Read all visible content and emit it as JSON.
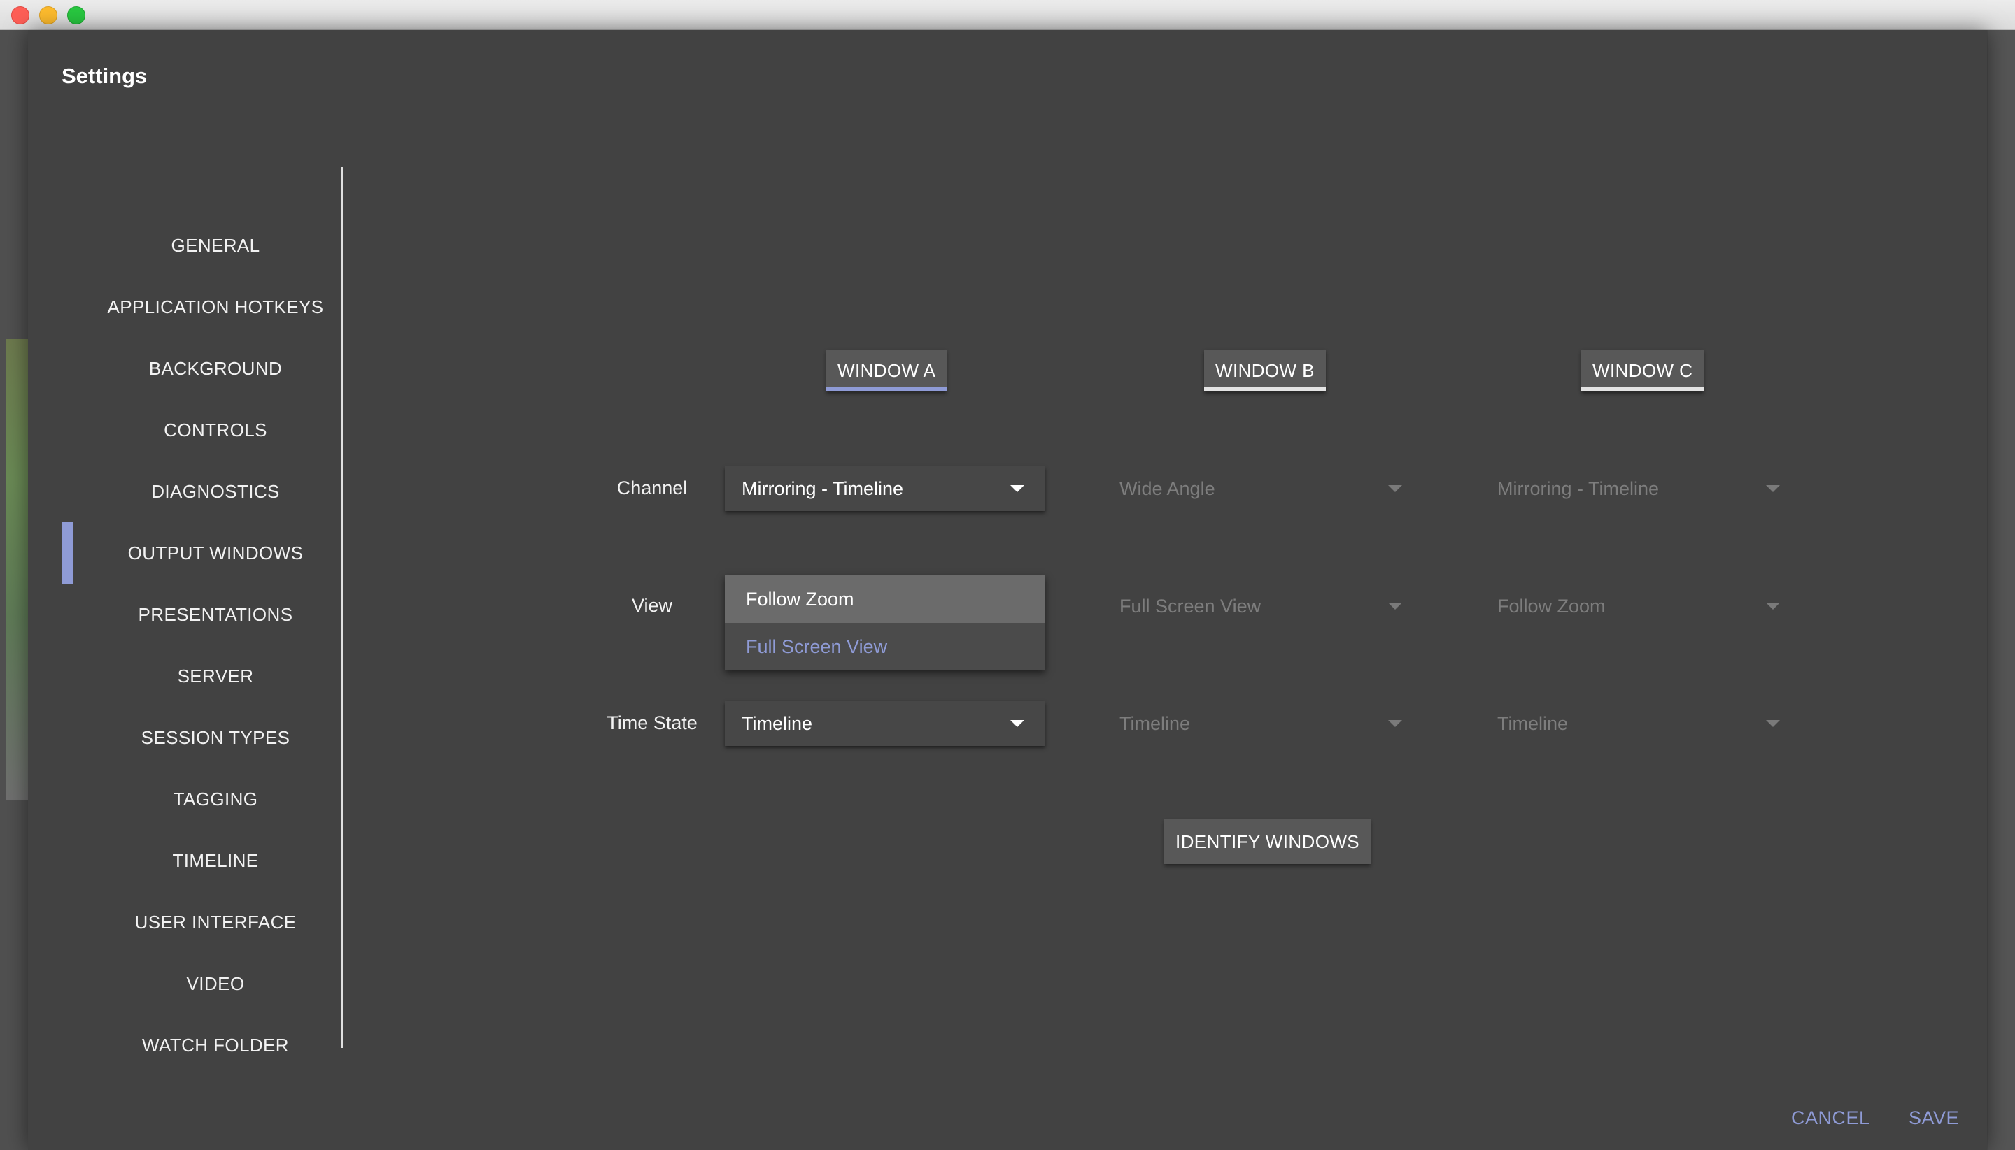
{
  "dialog": {
    "title": "Settings"
  },
  "nav": {
    "items": [
      {
        "label": "GENERAL"
      },
      {
        "label": "APPLICATION HOTKEYS"
      },
      {
        "label": "BACKGROUND"
      },
      {
        "label": "CONTROLS"
      },
      {
        "label": "DIAGNOSTICS"
      },
      {
        "label": "OUTPUT WINDOWS",
        "active": true
      },
      {
        "label": "PRESENTATIONS"
      },
      {
        "label": "SERVER"
      },
      {
        "label": "SESSION TYPES"
      },
      {
        "label": "TAGGING"
      },
      {
        "label": "TIMELINE"
      },
      {
        "label": "USER INTERFACE"
      },
      {
        "label": "VIDEO"
      },
      {
        "label": "WATCH FOLDER"
      }
    ]
  },
  "windows": [
    {
      "label": "WINDOW A",
      "active": true
    },
    {
      "label": "WINDOW B",
      "active": false
    },
    {
      "label": "WINDOW C",
      "active": false
    }
  ],
  "rows": {
    "channel": {
      "label": "Channel",
      "values": [
        "Mirroring - Timeline",
        "Wide Angle",
        "Mirroring - Timeline"
      ]
    },
    "view": {
      "label": "View",
      "values": [
        "Follow Zoom",
        "Full Screen View",
        "Follow Zoom"
      ]
    },
    "time_state": {
      "label": "Time State",
      "values": [
        "Timeline",
        "Timeline",
        "Timeline"
      ]
    }
  },
  "view_dropdown": {
    "options": [
      "Follow Zoom",
      "Full Screen View"
    ],
    "highlighted": "Follow Zoom",
    "selected": "Full Screen View"
  },
  "actions": {
    "identify_windows": "IDENTIFY WINDOWS",
    "cancel": "CANCEL",
    "save": "SAVE"
  },
  "colors": {
    "accent": "#8f9bd6",
    "dialog_bg": "#424242",
    "button_bg": "#585858"
  }
}
